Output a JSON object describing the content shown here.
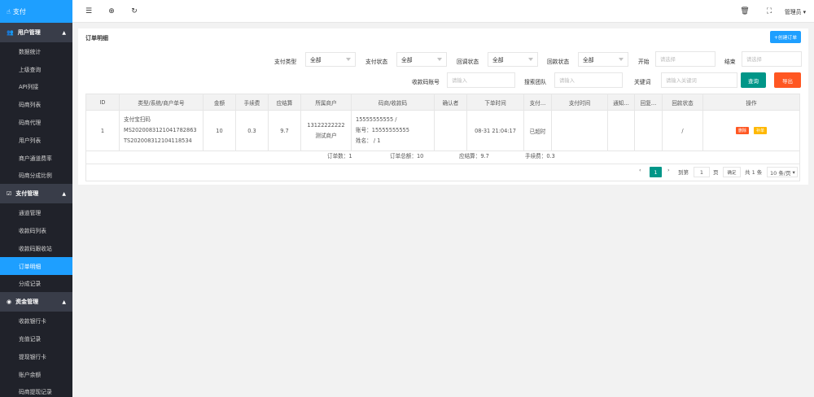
{
  "logo": {
    "text": "支付",
    "icon": "hand-icon"
  },
  "sidebar": {
    "groups": [
      {
        "title": "用户管理",
        "icon": "users-icon",
        "items": [
          "数据统计",
          "上级查询",
          "API列接",
          "码商列表",
          "码商代理",
          "用户列表",
          "商户通道费率",
          "码商分成比例"
        ]
      },
      {
        "title": "支付管理",
        "icon": "pay-icon",
        "items": [
          "通道管理",
          "收款码列表",
          "收款码跟收站",
          "订单明细",
          "分成记录"
        ]
      },
      {
        "title": "资金管理",
        "icon": "money-icon",
        "items": [
          "收款银行卡",
          "充值记录",
          "提现银行卡",
          "账户余额",
          "码商提现记录"
        ]
      }
    ],
    "active_item": "订单明细"
  },
  "topbar": {
    "admin_label": "管理员"
  },
  "panel": {
    "title": "订单明细",
    "create_button": "+创建订单",
    "query_button": "查询",
    "export_button": "导出"
  },
  "filters": {
    "pay_type": {
      "label": "支付类型",
      "value": "全部"
    },
    "pay_status": {
      "label": "支付状态",
      "value": "全部"
    },
    "callback_status": {
      "label": "回调状态",
      "value": "全部"
    },
    "refund_status": {
      "label": "回款状态",
      "value": "全部"
    },
    "start": {
      "label": "开始",
      "placeholder": "请选择"
    },
    "end": {
      "label": "结束",
      "placeholder": "请选择"
    },
    "account": {
      "label": "收款码账号",
      "placeholder": "请输入"
    },
    "team": {
      "label": "搜索团队",
      "placeholder": "请输入"
    },
    "keyword": {
      "label": "关键词",
      "placeholder": "请输入关键词"
    }
  },
  "table": {
    "headers": [
      "ID",
      "类型/系统/商户单号",
      "金额",
      "手续费",
      "应结算",
      "所属商户",
      "码商/收款码",
      "确认者",
      "下单时间",
      "支付…",
      "支付时间",
      "通知…",
      "回复…",
      "回款状态",
      "操作"
    ],
    "rows": [
      {
        "id": "1",
        "type_lines": [
          "支付宝扫码",
          "MS202008312104178286​3",
          "TS202008312104118534"
        ],
        "amount": "10",
        "fee": "0.3",
        "settle": "9.7",
        "merchant_lines": [
          "13122222222",
          "测试商户"
        ],
        "code_lines": [
          "15555555555 /",
          "账号：15555555555",
          "姓名：           / 1"
        ],
        "confirmer": "",
        "order_time": "08-31 21:04:17",
        "pay_status": "已超时",
        "pay_time": "",
        "notify": "",
        "reply": "",
        "refund_status": "/",
        "delete_label": "删除",
        "callback_label": "补单"
      }
    ],
    "summary": {
      "count": "订单数：1",
      "total": "订单总额：10",
      "settle": "应结算：9.7",
      "fee": "手续费：0.3"
    }
  },
  "pagination": {
    "current_page": "1",
    "goto_label": "到第",
    "goto_value": "1",
    "page_unit": "页",
    "confirm": "确定",
    "total": "共 1 条",
    "page_size": "10 条/页"
  }
}
